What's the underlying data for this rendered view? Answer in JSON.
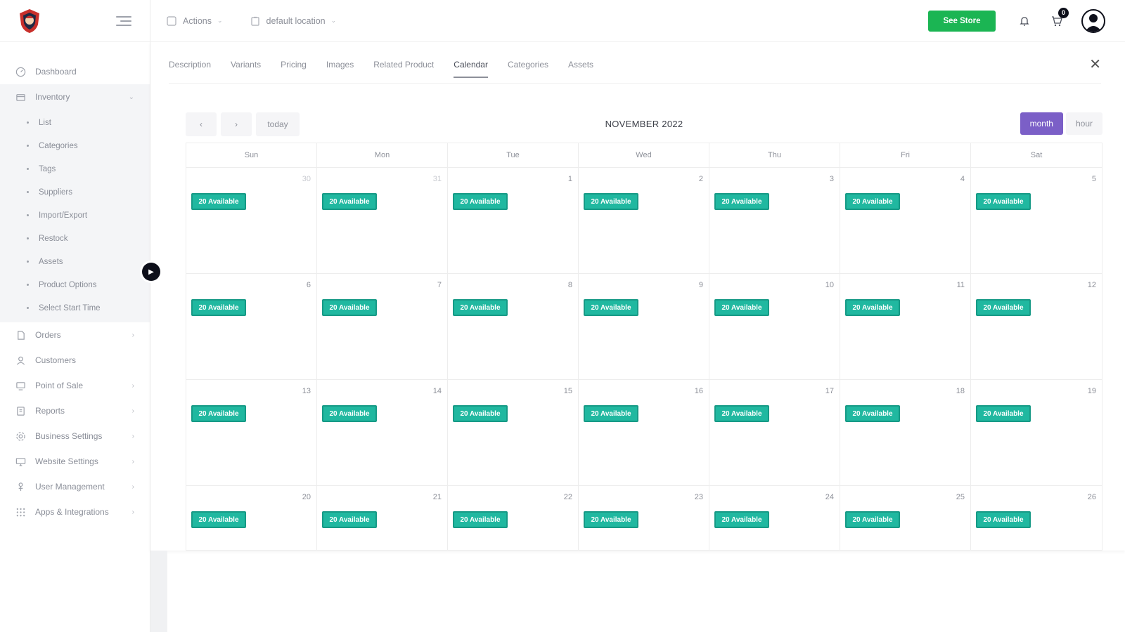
{
  "header": {
    "actions_label": "Actions",
    "location_label": "default location",
    "see_store_label": "See Store",
    "cart_count": "0"
  },
  "sidebar": {
    "items": [
      {
        "label": "Dashboard",
        "icon": "dashboard-icon"
      },
      {
        "label": "Inventory",
        "icon": "inventory-icon"
      },
      {
        "label": "Orders",
        "icon": "orders-icon"
      },
      {
        "label": "Customers",
        "icon": "customers-icon"
      },
      {
        "label": "Point of Sale",
        "icon": "pos-icon"
      },
      {
        "label": "Reports",
        "icon": "reports-icon"
      },
      {
        "label": "Business Settings",
        "icon": "settings-icon"
      },
      {
        "label": "Website Settings",
        "icon": "monitor-icon"
      },
      {
        "label": "User Management",
        "icon": "user-mgmt-icon"
      },
      {
        "label": "Apps & Integrations",
        "icon": "apps-icon"
      }
    ],
    "inventory_sub": [
      "List",
      "Categories",
      "Tags",
      "Suppliers",
      "Import/Export",
      "Restock",
      "Assets",
      "Product Options",
      "Select Start Time"
    ]
  },
  "tabs": [
    "Description",
    "Variants",
    "Pricing",
    "Images",
    "Related Product",
    "Calendar",
    "Categories",
    "Assets"
  ],
  "active_tab": "Calendar",
  "calendar": {
    "title": "NOVEMBER 2022",
    "prev": "‹",
    "next": "›",
    "today_label": "today",
    "views": [
      "month",
      "hour"
    ],
    "active_view": "month",
    "weekdays": [
      "Sun",
      "Mon",
      "Tue",
      "Wed",
      "Thu",
      "Fri",
      "Sat"
    ],
    "event_label": "20 Available",
    "weeks": [
      [
        {
          "d": "30",
          "m": true
        },
        {
          "d": "31",
          "m": true
        },
        {
          "d": "1"
        },
        {
          "d": "2"
        },
        {
          "d": "3"
        },
        {
          "d": "4"
        },
        {
          "d": "5"
        }
      ],
      [
        {
          "d": "6"
        },
        {
          "d": "7"
        },
        {
          "d": "8"
        },
        {
          "d": "9"
        },
        {
          "d": "10"
        },
        {
          "d": "11"
        },
        {
          "d": "12"
        }
      ],
      [
        {
          "d": "13"
        },
        {
          "d": "14"
        },
        {
          "d": "15"
        },
        {
          "d": "16"
        },
        {
          "d": "17"
        },
        {
          "d": "18"
        },
        {
          "d": "19"
        }
      ],
      [
        {
          "d": "20"
        },
        {
          "d": "21"
        },
        {
          "d": "22"
        },
        {
          "d": "23"
        },
        {
          "d": "24"
        },
        {
          "d": "25"
        },
        {
          "d": "26"
        }
      ]
    ]
  },
  "colors": {
    "accent_green": "#1bb553",
    "event_teal": "#20b8a0",
    "view_purple": "#7b5fc7"
  }
}
